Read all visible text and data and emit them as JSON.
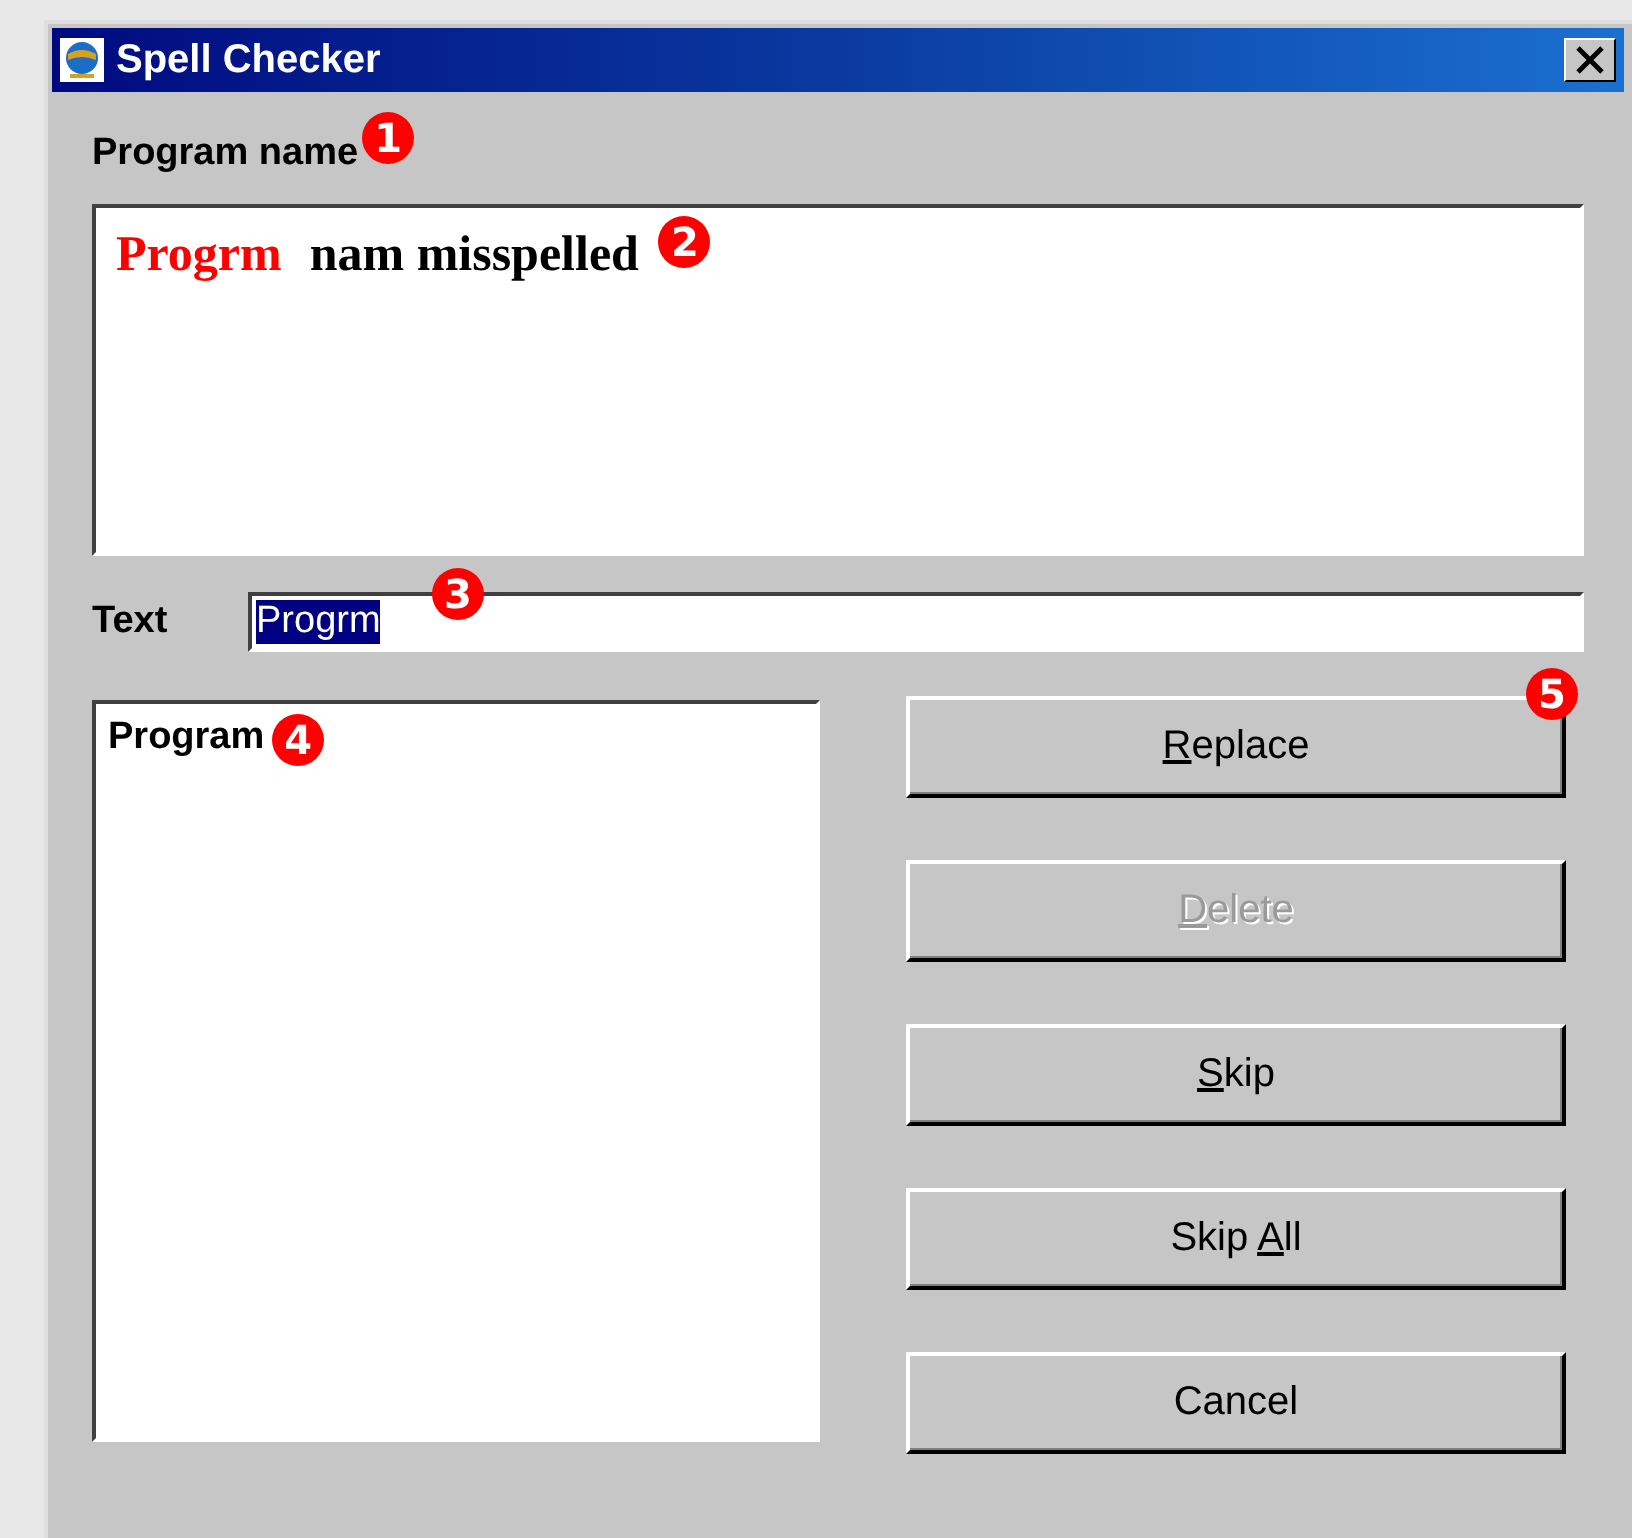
{
  "window": {
    "title": "Spell Checker"
  },
  "program_name": {
    "label": "Program name",
    "callout": "1"
  },
  "preview": {
    "segments": [
      {
        "text": "Progrm",
        "misspelled": true
      },
      {
        "text": "nam misspelled",
        "misspelled": false
      }
    ],
    "callout": "2"
  },
  "text_field": {
    "label": "Text",
    "value": "Progrm",
    "highlighted": true,
    "callout": "3"
  },
  "suggestions": {
    "items": [
      {
        "text": "Program",
        "selected": false
      }
    ],
    "callout": "4"
  },
  "buttons": [
    {
      "mnemonic": "R",
      "label_after": "eplace",
      "disabled": false,
      "callout": "5"
    },
    {
      "mnemonic": "D",
      "label_after": "elete",
      "disabled": true
    },
    {
      "mnemonic": "S",
      "label_after": "kip",
      "disabled": false
    },
    {
      "label_before": "Skip ",
      "mnemonic": "A",
      "label_after": "ll",
      "disabled": false
    },
    {
      "label_before": "Cancel",
      "disabled": false
    }
  ]
}
